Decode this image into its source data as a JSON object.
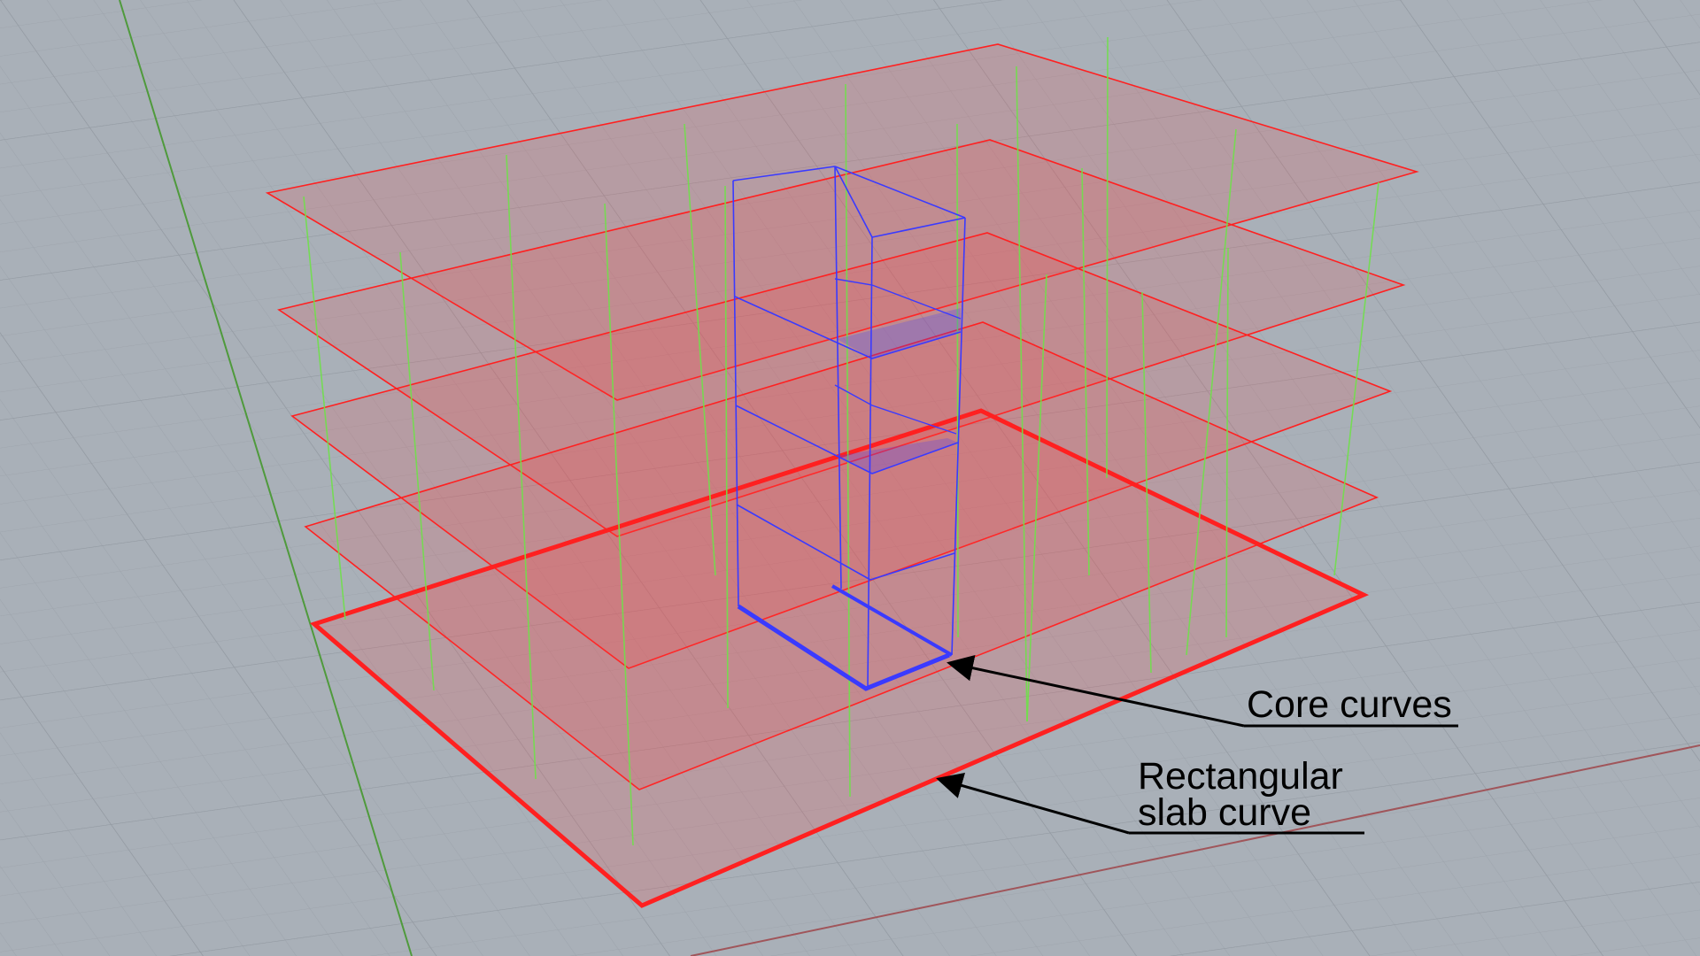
{
  "viewport": {
    "background_color": "#a9b0b8",
    "grid_color": "#9ca3ab",
    "grid_major_color": "#8e959d",
    "axis_x_color": "#a0555a",
    "axis_y_color": "#4f9a3c"
  },
  "model": {
    "slab_color": "#ff2020",
    "slab_fill": "#ff3b3b",
    "core_color": "#3a3aff",
    "column_color": "#6fe04a",
    "slab_count": 5
  },
  "annotations": [
    {
      "id": "core",
      "lines": [
        "Core curves"
      ]
    },
    {
      "id": "slab",
      "lines": [
        "Rectangular",
        "slab curve"
      ]
    }
  ]
}
